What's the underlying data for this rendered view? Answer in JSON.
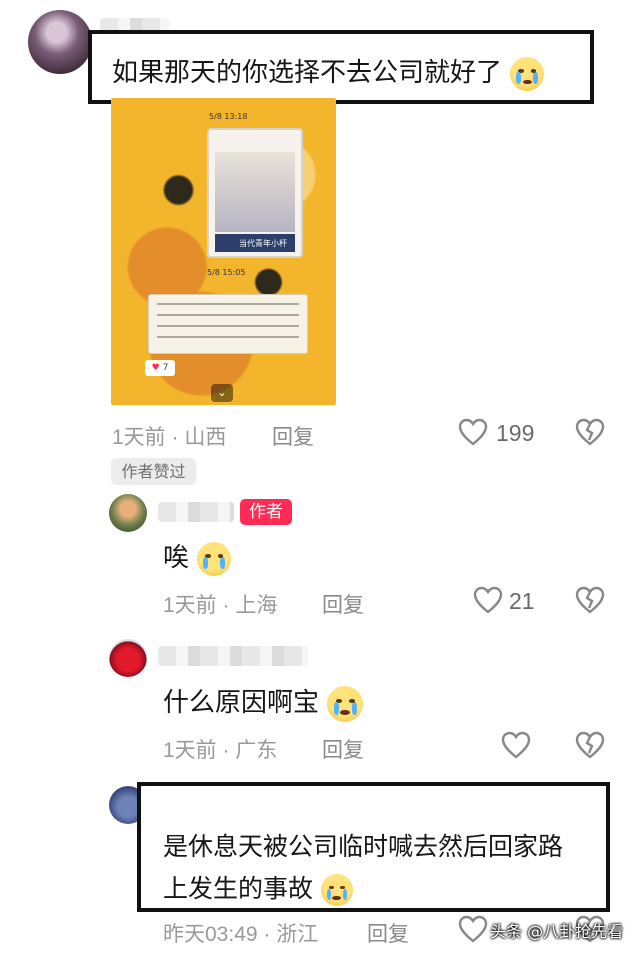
{
  "comments": [
    {
      "text": "如果那天的你选择不去公司就好了",
      "time": "1天前 · 山西",
      "reply_label": "回复",
      "likes": "199",
      "image": {
        "timestamp_top": "5/8 13:18",
        "timestamp_mid": "5/8 15:05",
        "card_caption": "当代青年小杆",
        "bubble_text": "下班回到住处能看到爸妈的一两句关心真的会让自己感到处于被关怀的状态 反正上班不用这么卖力，做好自己的岗位就行",
        "react_count": "7",
        "expand_icon": "chevron-down-icon"
      },
      "liked_by_author_tag": "作者赞过"
    },
    {
      "author_badge": "作者",
      "text": "唉",
      "time": "1天前 · 上海",
      "reply_label": "回复",
      "likes": "21"
    },
    {
      "text": "什么原因啊宝",
      "time": "1天前 · 广东",
      "reply_label": "回复",
      "likes": ""
    },
    {
      "text_line1": "是休息天被公司临时喊去然后回家路",
      "text_line2": "上发生的事故",
      "time": "昨天03:49 · 浙江",
      "reply_label": "回复",
      "likes": ""
    }
  ],
  "watermark": "头条 @八卦抢先看",
  "colors": {
    "author_badge": "#fe2c55",
    "meta": "#9a9a9a"
  }
}
